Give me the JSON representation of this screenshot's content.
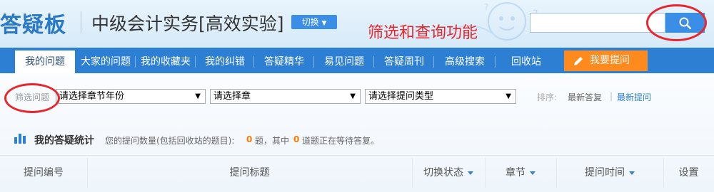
{
  "header": {
    "logo": "答疑板",
    "course_title": "中级会计实务[高效实验]",
    "switch_label": "切换",
    "annotation": "筛选和查询功能",
    "search": {
      "value": "",
      "placeholder": ""
    }
  },
  "nav": {
    "items": [
      {
        "label": "我的问题",
        "active": true
      },
      {
        "label": "大家的问题"
      },
      {
        "label": "我的收藏夹"
      },
      {
        "label": "我的纠错"
      },
      {
        "label": "答疑精华"
      },
      {
        "label": "易见问题"
      },
      {
        "label": "答疑周刊"
      },
      {
        "label": "高级搜索"
      },
      {
        "label": "回收站"
      }
    ],
    "ask_label": "我要提问"
  },
  "filter": {
    "label": "筛选问题",
    "selects": [
      {
        "value": "请选择章节年份"
      },
      {
        "value": "请选择章"
      },
      {
        "value": "请选择提问类型"
      }
    ],
    "sort_label": "排序:",
    "sort_options": [
      {
        "label": "最新答复",
        "color": "#666666"
      },
      {
        "label": "最新提问",
        "color": "#2c7fd3"
      }
    ],
    "sort_separator": "|"
  },
  "stats": {
    "title": "我的答疑统计",
    "desc_prefix": "您的提问数量(包括回收站的题目):",
    "question_count": "0",
    "desc_middle": "题，其中",
    "waiting_count": "0",
    "desc_suffix": "道题正在等待答复。"
  },
  "table": {
    "columns": [
      {
        "label": "提问编号"
      },
      {
        "label": "提问标题"
      },
      {
        "label": "切换状态",
        "sortable": true
      },
      {
        "label": "章节",
        "sortable": true
      },
      {
        "label": "提问时间",
        "sortable": true
      },
      {
        "label": "设置"
      }
    ]
  },
  "colors": {
    "accent": "#2c7fd3",
    "ask_button": "#ff8a1e",
    "annotation": "#e8262e",
    "count": "#ff7a00"
  },
  "icons": {
    "search": "search-icon",
    "pencil": "pencil-icon",
    "stats": "bar-chart-icon",
    "switch_caret": "caret-down-icon"
  }
}
